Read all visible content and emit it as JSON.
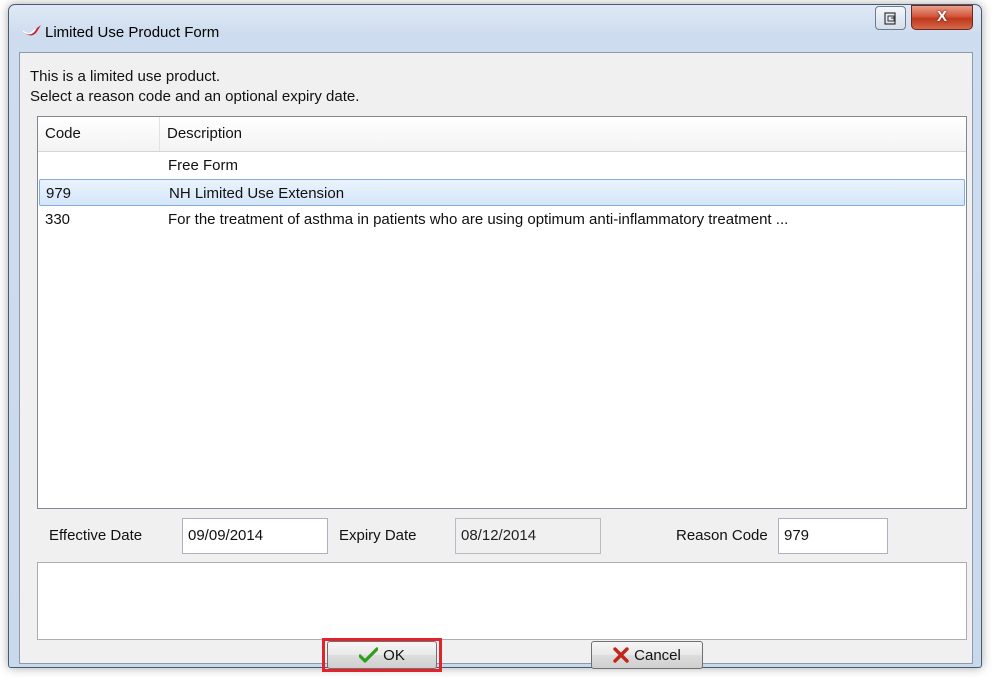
{
  "window": {
    "title": "Limited Use Product Form",
    "close_label": "X"
  },
  "intro": {
    "line1": "This is a limited use product.",
    "line2": "Select a reason code and an optional expiry date."
  },
  "list": {
    "columns": {
      "code": "Code",
      "description": "Description"
    },
    "rows": [
      {
        "code": "",
        "description": "Free Form",
        "selected": false
      },
      {
        "code": "979",
        "description": "NH Limited Use Extension",
        "selected": true
      },
      {
        "code": "330",
        "description": "For the treatment of asthma in patients who are using optimum anti-inflammatory treatment ...",
        "selected": false
      }
    ]
  },
  "fields": {
    "effective_label": "Effective Date",
    "effective_value": "09/09/2014",
    "expiry_label": "Expiry Date",
    "expiry_value": "08/12/2014",
    "reason_label": "Reason Code",
    "reason_value": "979"
  },
  "buttons": {
    "ok": "OK",
    "cancel": "Cancel"
  },
  "colors": {
    "selection": "#d4e6fa",
    "highlight": "#e0242d",
    "ok_check": "#2e9e1c",
    "cancel_x": "#c0271a"
  }
}
